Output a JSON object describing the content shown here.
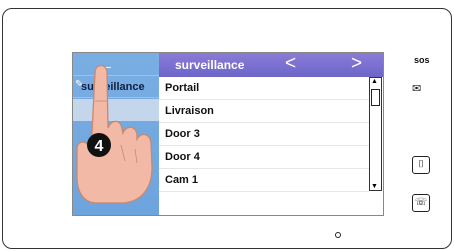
{
  "screen": {
    "sidebar": {
      "back_glyph": "←",
      "items": [
        {
          "label": "surveillance"
        }
      ]
    },
    "header": {
      "title": "surveillance",
      "prev_glyph": "<",
      "next_glyph": ">"
    },
    "list": {
      "items": [
        {
          "label": "Portail"
        },
        {
          "label": "Livraison"
        },
        {
          "label": "Door 3"
        },
        {
          "label": "Door 4"
        },
        {
          "label": "Cam 1"
        }
      ]
    },
    "step_marker": "4"
  },
  "side_buttons": {
    "sos_label": "sos",
    "mail_icon": "envelope-icon",
    "door_icon": "door-icon",
    "talk_icon": "talk-icon"
  }
}
